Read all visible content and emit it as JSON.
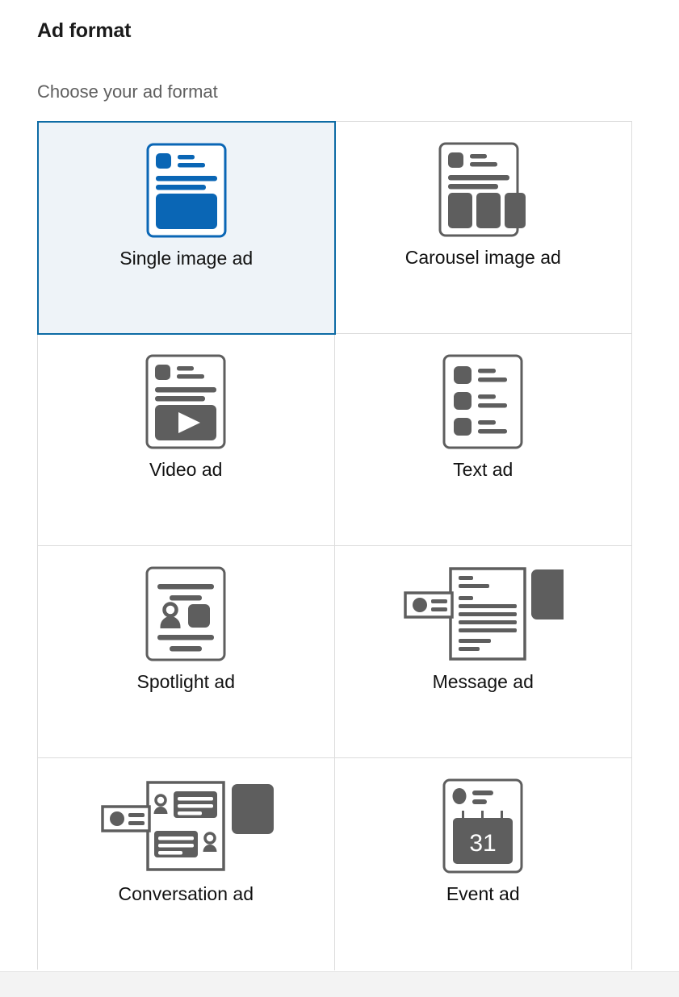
{
  "section": {
    "title": "Ad format",
    "subtitle": "Choose your ad format"
  },
  "colors": {
    "selected_border": "#0d6ba5",
    "selected_background": "#eef3f8",
    "icon_blue": "#0a66b5",
    "icon_gray": "#5e5e5e",
    "divider": "#dcdcdc",
    "label_text": "#111111",
    "subtitle_text": "#5f5f5f"
  },
  "formats": [
    {
      "label": "Single image ad",
      "icon": "single-image-ad-icon",
      "selected": true
    },
    {
      "label": "Carousel image ad",
      "icon": "carousel-image-ad-icon",
      "selected": false
    },
    {
      "label": "Video ad",
      "icon": "video-ad-icon",
      "selected": false
    },
    {
      "label": "Text ad",
      "icon": "text-ad-icon",
      "selected": false
    },
    {
      "label": "Spotlight ad",
      "icon": "spotlight-ad-icon",
      "selected": false
    },
    {
      "label": "Message ad",
      "icon": "message-ad-icon",
      "selected": false
    },
    {
      "label": "Conversation ad",
      "icon": "conversation-ad-icon",
      "selected": false
    },
    {
      "label": "Event ad",
      "icon": "event-ad-icon",
      "selected": false,
      "calendar_day": "31"
    }
  ]
}
